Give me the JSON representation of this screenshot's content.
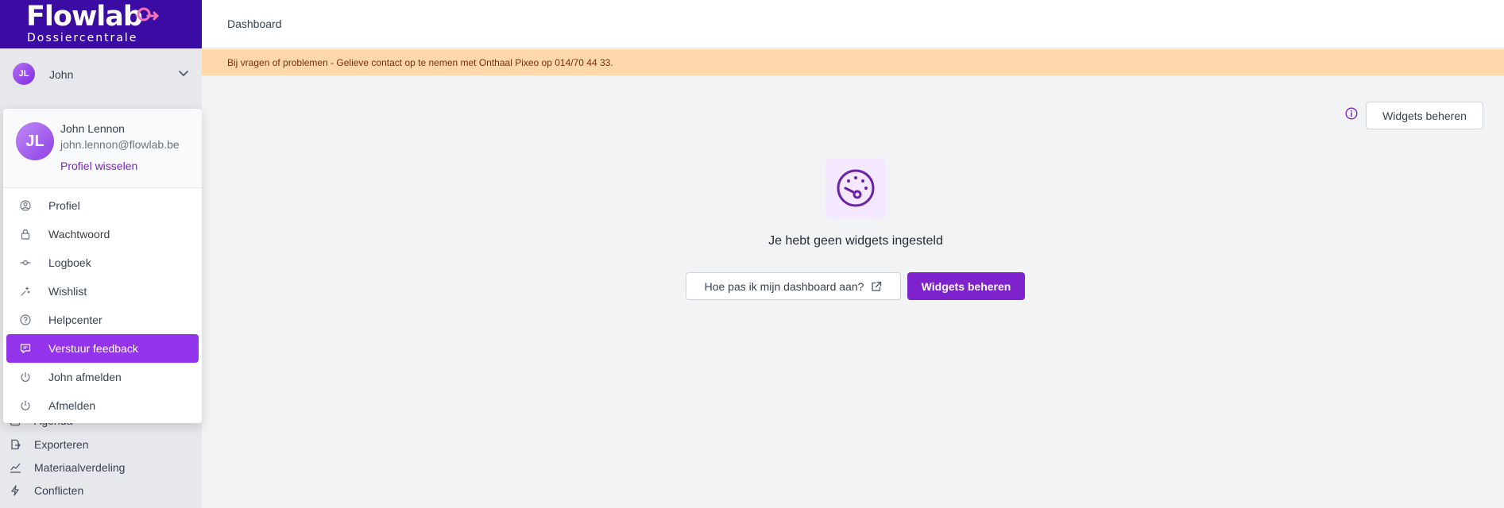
{
  "brand": {
    "name": "Flowlab",
    "subtitle": "Dossiercentrale",
    "color": "#3a0ca3",
    "accent": "#7e22ce"
  },
  "user": {
    "initials": "JL",
    "short_name": "John",
    "full_name": "John Lennon",
    "email": "john.lennon@flowlab.be",
    "switch_label": "Profiel wisselen"
  },
  "user_menu": [
    {
      "label": "Profiel",
      "icon": "user-circle-icon"
    },
    {
      "label": "Wachtwoord",
      "icon": "lock-icon"
    },
    {
      "label": "Logboek",
      "icon": "commit-icon"
    },
    {
      "label": "Wishlist",
      "icon": "sparkles-icon"
    },
    {
      "label": "Helpcenter",
      "icon": "question-circle-icon"
    },
    {
      "label": "Verstuur feedback",
      "icon": "chat-icon",
      "active": true
    },
    {
      "label": "John afmelden",
      "icon": "power-icon"
    },
    {
      "label": "Afmelden",
      "icon": "power-icon"
    }
  ],
  "sidebar": {
    "items": [
      {
        "label": "Agenda",
        "icon": "calendar-icon"
      },
      {
        "label": "Exporteren",
        "icon": "export-icon"
      },
      {
        "label": "Materiaalverdeling",
        "icon": "chart-icon"
      },
      {
        "label": "Conflicten",
        "icon": "bolt-icon"
      }
    ]
  },
  "header": {
    "breadcrumb": "Dashboard"
  },
  "banner": {
    "text": "Bij vragen of problemen - Gelieve contact op te nemen met Onthaal Pixeo op 014/70 44 33."
  },
  "dashboard": {
    "manage_widgets_label": "Widgets beheren",
    "empty_text": "Je hebt geen widgets ingesteld",
    "help_button_label": "Hoe pas ik mijn dashboard aan?",
    "primary_button_label": "Widgets beheren"
  }
}
